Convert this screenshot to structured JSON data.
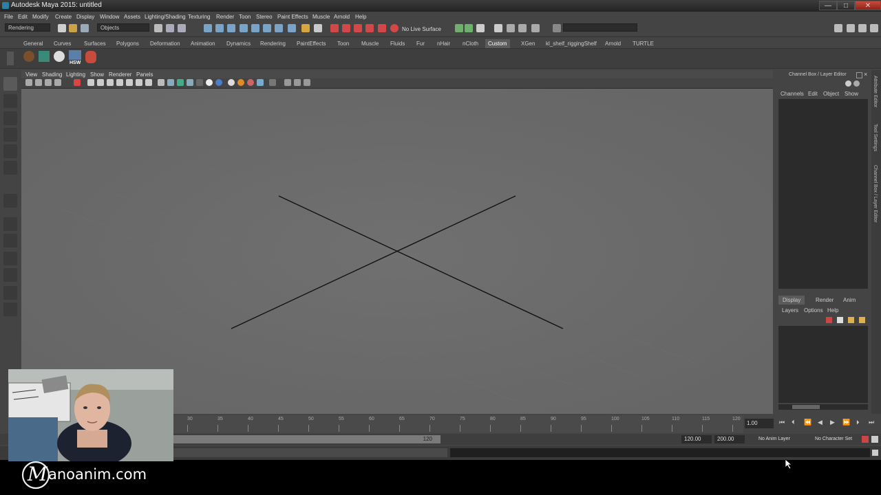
{
  "window": {
    "title": "Autodesk Maya 2015: untitled",
    "min": "—",
    "max": "□",
    "close": "✕"
  },
  "menubar": [
    "File",
    "Edit",
    "Modify",
    "Create",
    "Display",
    "Window",
    "Assets",
    "Lighting/Shading",
    "Texturing",
    "Render",
    "Toon",
    "Stereo",
    "Paint Effects",
    "Muscle",
    "Arnold",
    "Help"
  ],
  "statusline": {
    "menuset": "Rendering",
    "selection_mode": "Objects",
    "live_surface": "No Live Surface"
  },
  "shelf": {
    "tabs": [
      "General",
      "Curves",
      "Surfaces",
      "Polygons",
      "Deformation",
      "Animation",
      "Dynamics",
      "Rendering",
      "PaintEffects",
      "Toon",
      "Muscle",
      "Fluids",
      "Fur",
      "nHair",
      "nCloth",
      "Custom",
      "XGen",
      "kl_shelf_riggingShelf",
      "Arnold",
      "TURTLE"
    ],
    "active_tab": "Custom",
    "button_label": "HSW"
  },
  "panel": {
    "menus": [
      "View",
      "Shading",
      "Lighting",
      "Show",
      "Renderer",
      "Panels"
    ]
  },
  "channelbox": {
    "title": "Channel Box / Layer Editor",
    "menus": [
      "Channels",
      "Edit",
      "Object",
      "Show"
    ]
  },
  "layereditor": {
    "tabs": [
      "Display",
      "Render",
      "Anim"
    ],
    "active_tab": "Display",
    "menus": [
      "Layers",
      "Options",
      "Help"
    ]
  },
  "sidetabs": [
    "Attribute Editor",
    "Tool Settings",
    "Channel Box / Layer Editor"
  ],
  "timeline": {
    "ticks": [
      "30",
      "35",
      "40",
      "45",
      "50",
      "55",
      "60",
      "65",
      "70",
      "75",
      "80",
      "85",
      "90",
      "95",
      "100",
      "105",
      "110",
      "115",
      "120"
    ],
    "current_frame": "1.00"
  },
  "range": {
    "end_label": "120",
    "anim_end": "120.00",
    "playback_end": "200.00",
    "anim_layer": "No Anim Layer",
    "char_set": "No Character Set"
  },
  "watermark": {
    "text": "anoanim.com",
    "logo_letter": "M"
  },
  "colors": {
    "viewport": "#686868",
    "ui": "#444444",
    "accent": "#5b5b5b"
  }
}
